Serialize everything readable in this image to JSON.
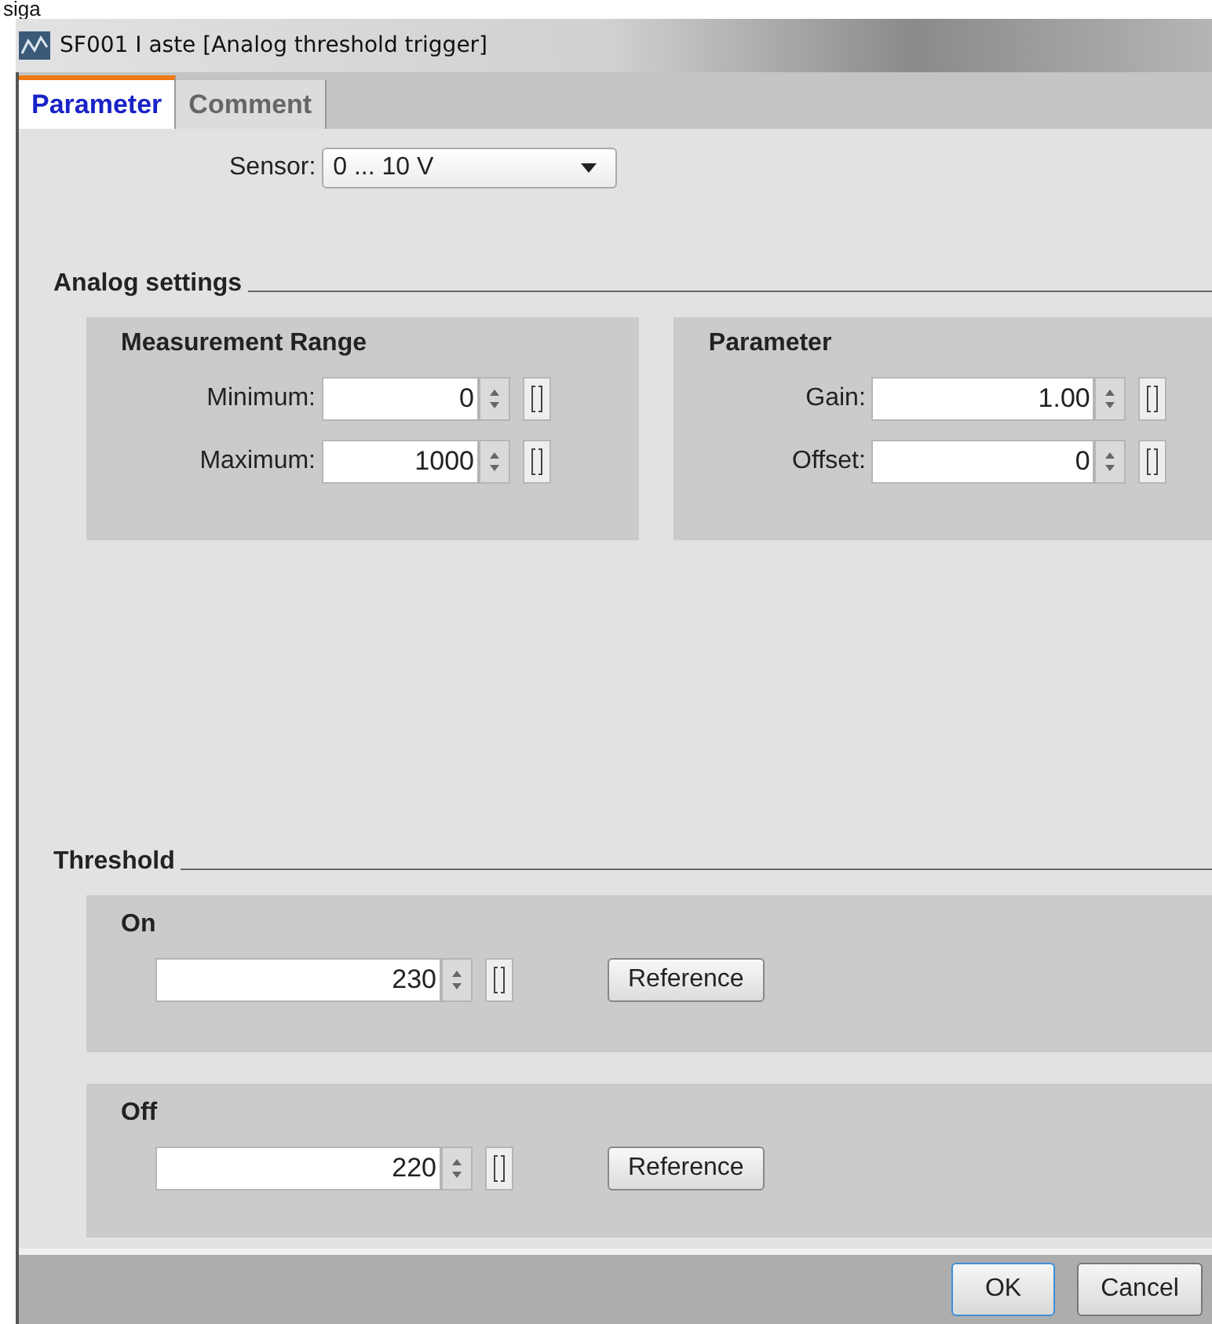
{
  "top_text": "siga",
  "window": {
    "title": "SF001 I aste [Analog threshold trigger]"
  },
  "tabs": [
    {
      "label": "Parameter",
      "selected": true
    },
    {
      "label": "Comment",
      "selected": false
    }
  ],
  "sensor": {
    "label": "Sensor:",
    "value": "0 ... 10 V"
  },
  "analog_settings": {
    "title": "Analog settings",
    "groups": [
      {
        "title": "Measurement Range",
        "fields": [
          {
            "label": "Minimum:",
            "value": "0"
          },
          {
            "label": "Maximum:",
            "value": "1000"
          }
        ]
      },
      {
        "title": "Parameter",
        "fields": [
          {
            "label": "Gain:",
            "value": "1.00"
          },
          {
            "label": "Offset:",
            "value": "0"
          }
        ]
      }
    ]
  },
  "threshold": {
    "title": "Threshold",
    "groups": [
      {
        "title": "On",
        "value": "230",
        "button": "Reference"
      },
      {
        "title": "Off",
        "value": "220",
        "button": "Reference"
      }
    ]
  },
  "buttons": [
    "OK",
    "Cancel"
  ]
}
